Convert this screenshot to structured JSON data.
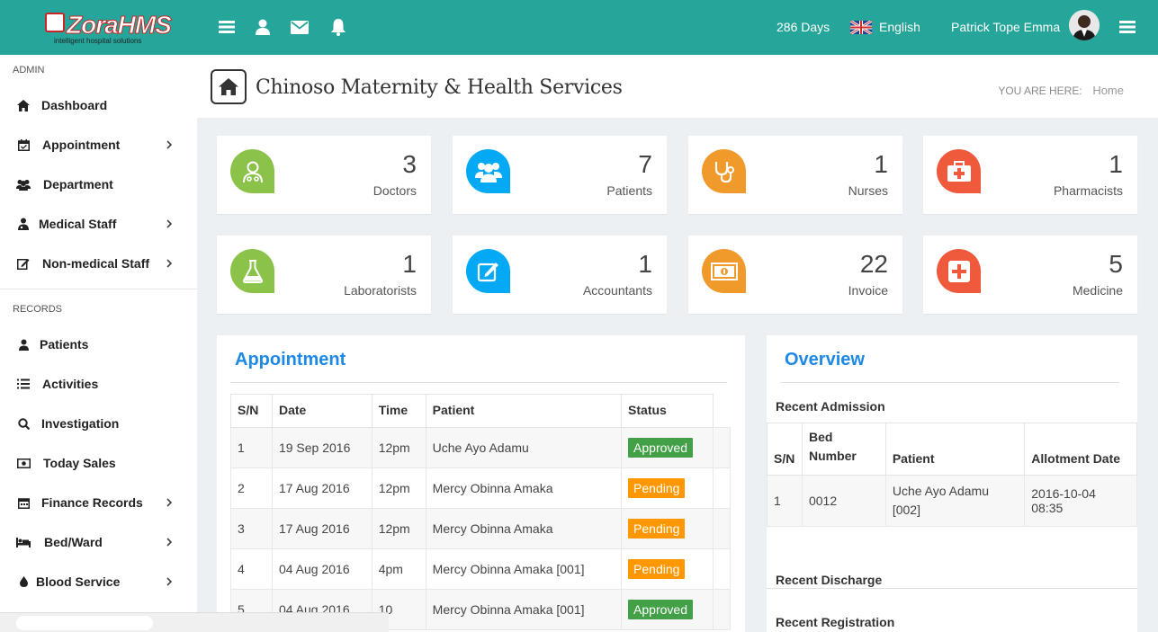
{
  "app": {
    "logo_text": "ZoraHMS",
    "logo_tagline": "intelligent hospital solutions"
  },
  "topbar": {
    "days": "286 Days",
    "language": "English",
    "user_name": "Patrick Tope Emma"
  },
  "sidebar": {
    "section_admin": "ADMIN",
    "section_records": "RECORDS",
    "admin_items": [
      {
        "label": "Dashboard",
        "icon": "home-icon",
        "has_submenu": false
      },
      {
        "label": "Appointment",
        "icon": "calendar-icon",
        "has_submenu": true
      },
      {
        "label": "Department",
        "icon": "users-icon",
        "has_submenu": false
      },
      {
        "label": "Medical Staff",
        "icon": "doctor-icon",
        "has_submenu": true
      },
      {
        "label": "Non-medical Staff",
        "icon": "edit-icon",
        "has_submenu": true
      }
    ],
    "record_items": [
      {
        "label": "Patients",
        "icon": "user-icon",
        "has_submenu": false
      },
      {
        "label": "Activities",
        "icon": "list-icon",
        "has_submenu": false
      },
      {
        "label": "Investigation",
        "icon": "search-icon",
        "has_submenu": false
      },
      {
        "label": "Today Sales",
        "icon": "money-icon",
        "has_submenu": false
      },
      {
        "label": "Finance Records",
        "icon": "calendar-icon",
        "has_submenu": true
      },
      {
        "label": "Bed/Ward",
        "icon": "bed-icon",
        "has_submenu": true
      },
      {
        "label": "Blood Service",
        "icon": "drop-icon",
        "has_submenu": true
      }
    ]
  },
  "header": {
    "title": "Chinoso Maternity & Health Services",
    "breadcrumb_label": "YOU ARE HERE:",
    "breadcrumb_current": "Home"
  },
  "stats": [
    {
      "count": "3",
      "label": "Doctors",
      "color": "#8bc34a",
      "icon": "doctor-icon"
    },
    {
      "count": "7",
      "label": "Patients",
      "color": "#03a9f4",
      "icon": "users-icon"
    },
    {
      "count": "1",
      "label": "Nurses",
      "color": "#ef9a2b",
      "icon": "stethoscope-icon"
    },
    {
      "count": "1",
      "label": "Pharmacists",
      "color": "#ef5a3c",
      "icon": "medkit-icon"
    },
    {
      "count": "1",
      "label": "Laboratorists",
      "color": "#8bc34a",
      "icon": "flask-icon"
    },
    {
      "count": "1",
      "label": "Accountants",
      "color": "#03a9f4",
      "icon": "edit-icon"
    },
    {
      "count": "22",
      "label": "Invoice",
      "color": "#ef9a2b",
      "icon": "money-icon"
    },
    {
      "count": "5",
      "label": "Medicine",
      "color": "#ef5a3c",
      "icon": "plus-square-icon"
    }
  ],
  "appointment": {
    "title": "Appointment",
    "columns": [
      "S/N",
      "Date",
      "Time",
      "Patient",
      "Status"
    ],
    "rows": [
      {
        "sn": "1",
        "date": "19 Sep 2016",
        "time": "12pm",
        "patient": "Uche Ayo Adamu",
        "status": "Approved"
      },
      {
        "sn": "2",
        "date": "17 Aug 2016",
        "time": "12pm",
        "patient": "Mercy Obinna Amaka",
        "status": "Pending"
      },
      {
        "sn": "3",
        "date": "17 Aug 2016",
        "time": "12pm",
        "patient": "Mercy Obinna Amaka",
        "status": "Pending"
      },
      {
        "sn": "4",
        "date": "04 Aug 2016",
        "time": "4pm",
        "patient": "Mercy Obinna Amaka [001]",
        "status": "Pending"
      },
      {
        "sn": "5",
        "date": "04 Aug 2016",
        "time": "10",
        "patient": "Mercy Obinna Amaka [001]",
        "status": "Approved"
      }
    ],
    "status_colors": {
      "Approved": "#43a047",
      "Pending": "#ff9800"
    }
  },
  "overview": {
    "title": "Overview",
    "recent_admission": "Recent Admission",
    "admission_columns": [
      "S/N",
      "Bed Number",
      "Patient",
      "Allotment Date"
    ],
    "admission_rows": [
      {
        "sn": "1",
        "bed": "0012",
        "patient": "Uche Ayo Adamu [002]",
        "date": "2016-10-04 08:35"
      }
    ],
    "recent_discharge": "Recent Discharge",
    "recent_registration": "Recent Registration"
  }
}
